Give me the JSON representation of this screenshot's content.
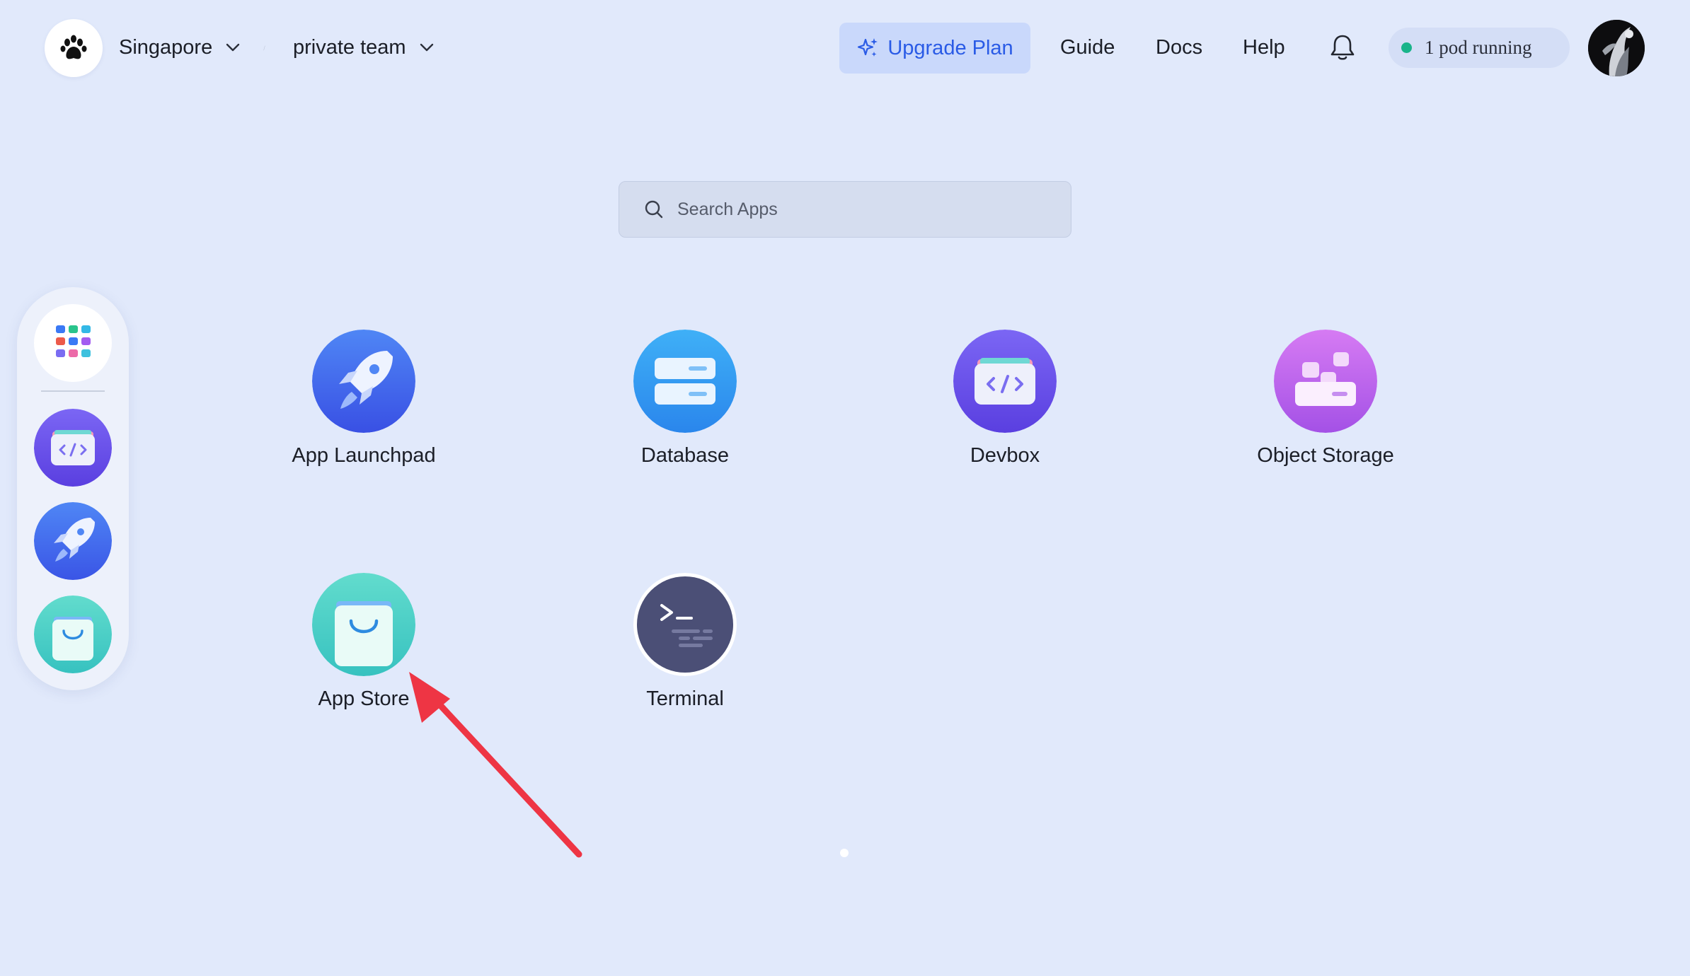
{
  "header": {
    "logo_icon": "paw-icon",
    "region_label": "Singapore",
    "team_label": "private team",
    "upgrade_label": "Upgrade Plan",
    "nav": {
      "guide": "Guide",
      "docs": "Docs",
      "help": "Help"
    },
    "pods_label": "1 pod running",
    "status_color": "#19b48a",
    "accent_color": "#2a5be6"
  },
  "search": {
    "placeholder": "Search Apps",
    "value": ""
  },
  "dock": {
    "items": [
      {
        "icon": "apps-grid-icon"
      },
      {
        "icon": "devbox-icon"
      },
      {
        "icon": "rocket-icon"
      },
      {
        "icon": "app-store-bag-icon"
      }
    ]
  },
  "apps": [
    {
      "label": "App Launchpad",
      "icon": "rocket-icon"
    },
    {
      "label": "Database",
      "icon": "database-icon"
    },
    {
      "label": "Devbox",
      "icon": "devbox-icon"
    },
    {
      "label": "Object Storage",
      "icon": "object-storage-icon"
    },
    {
      "label": "App Store",
      "icon": "app-store-bag-icon"
    },
    {
      "label": "Terminal",
      "icon": "terminal-icon"
    }
  ],
  "annotation": {
    "arrow_color": "#ee3544"
  }
}
